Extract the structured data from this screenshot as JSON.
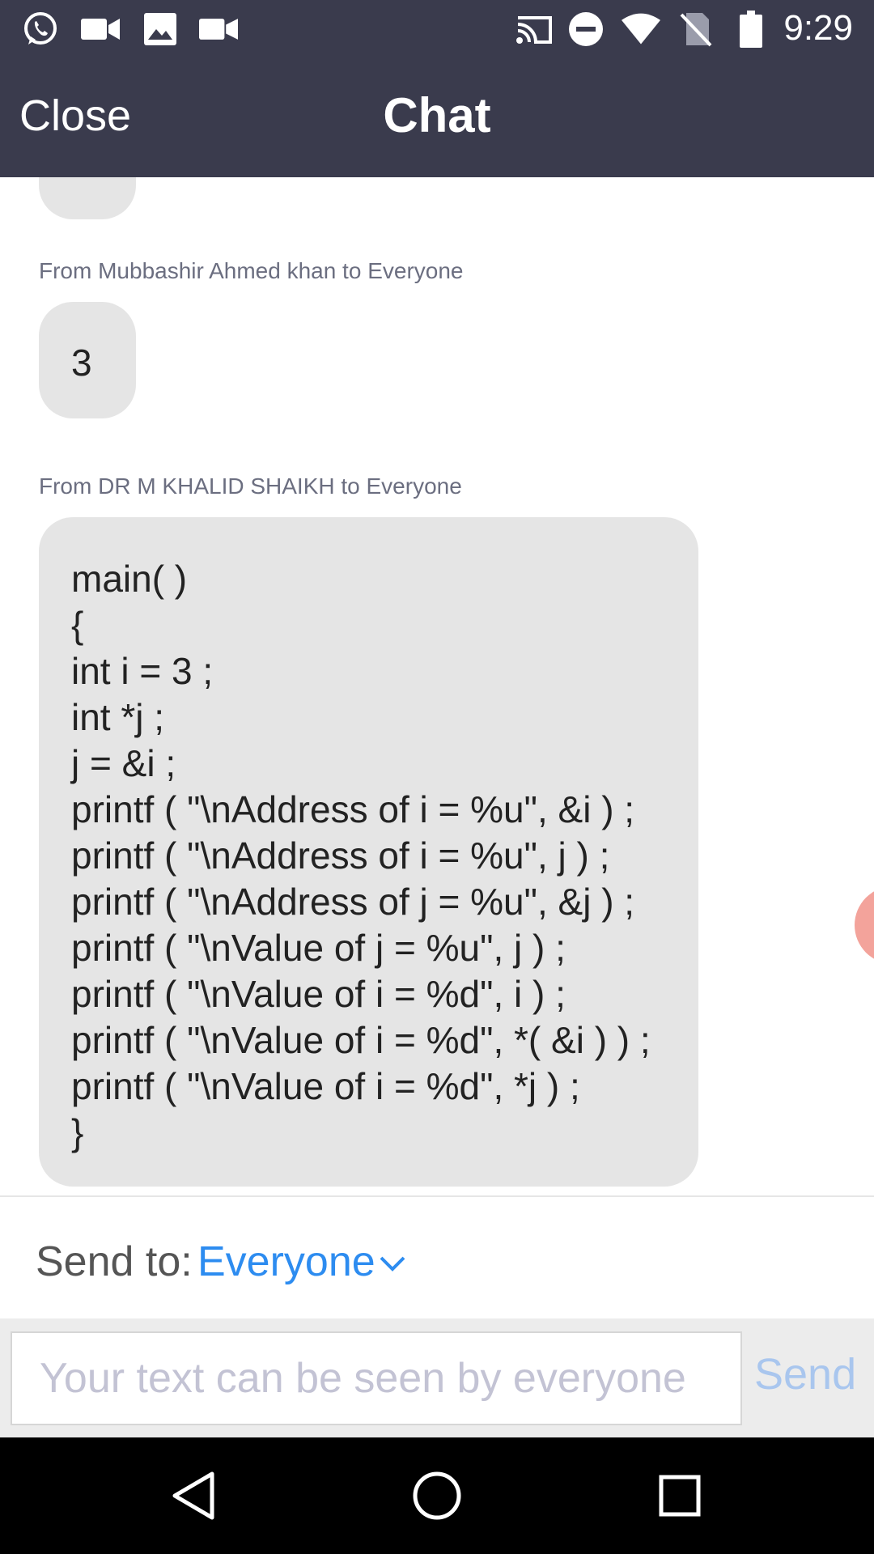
{
  "status_bar": {
    "time": "9:29",
    "left_icons": [
      "whatsapp-icon",
      "video-camera-icon",
      "image-icon",
      "video-camera-icon"
    ],
    "right_icons": [
      "cast-icon",
      "do-not-disturb-icon",
      "wifi-icon",
      "no-sim-icon",
      "battery-icon"
    ]
  },
  "header": {
    "close_label": "Close",
    "title": "Chat"
  },
  "messages": [
    {
      "sender": "From Mubbashir Ahmed khan to Everyone",
      "text": "3"
    },
    {
      "sender": "From DR M KHALID SHAIKH to Everyone",
      "lines": [
        "main( )",
        "{",
        "int i = 3 ;",
        "int *j ;",
        "j = &i ;",
        "printf ( \"\\nAddress of i = %u\", &i ) ;",
        "printf ( \"\\nAddress of i = %u\", j ) ;",
        "printf ( \"\\nAddress of j = %u\", &j ) ;",
        "printf ( \"\\nValue of j = %u\", j ) ;",
        "printf ( \"\\nValue of i = %d\", i ) ;",
        "printf ( \"\\nValue of i = %d\", *( &i ) ) ;",
        "printf ( \"\\nValue of i = %d\", *j ) ;",
        "}"
      ]
    }
  ],
  "send_to": {
    "label": "Send to:",
    "value": "Everyone"
  },
  "composer": {
    "placeholder": "Your text can be seen by everyone",
    "value": "",
    "send_label": "Send"
  },
  "colors": {
    "header_bg": "#3a3b4d",
    "accent": "#2d8cf0",
    "send_disabled": "#a9c6ee",
    "bubble_bg": "#e5e5e5"
  }
}
